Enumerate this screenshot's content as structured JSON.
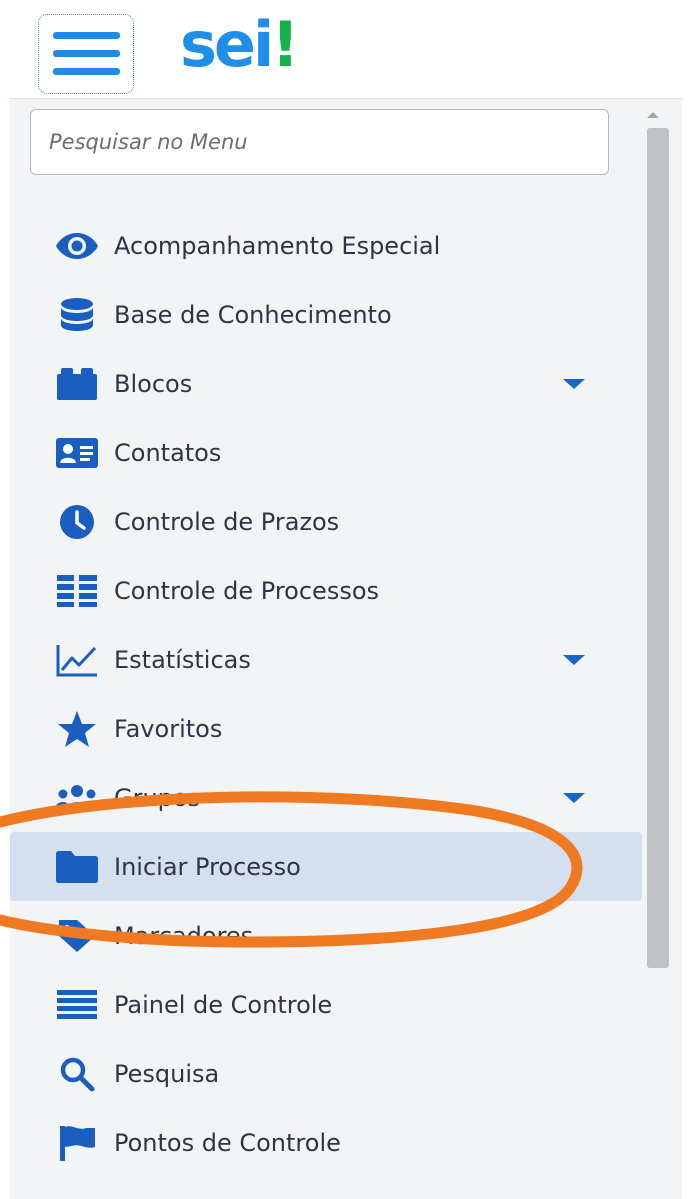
{
  "header": {
    "logo_text": "sei",
    "logo_exclamation": "!",
    "logo_color": "#1f8ee8",
    "logo_accent_color": "#13b24b"
  },
  "search": {
    "placeholder": "Pesquisar no Menu",
    "value": ""
  },
  "menu": {
    "items": [
      {
        "label": "Acompanhamento Especial",
        "icon": "eye-icon",
        "has_submenu": false,
        "active": false
      },
      {
        "label": "Base de Conhecimento",
        "icon": "database-icon",
        "has_submenu": false,
        "active": false
      },
      {
        "label": "Blocos",
        "icon": "cubes-icon",
        "has_submenu": true,
        "active": false
      },
      {
        "label": "Contatos",
        "icon": "address-card-icon",
        "has_submenu": false,
        "active": false
      },
      {
        "label": "Controle de Prazos",
        "icon": "clock-icon",
        "has_submenu": false,
        "active": false
      },
      {
        "label": "Controle de Processos",
        "icon": "list-grid-icon",
        "has_submenu": false,
        "active": false
      },
      {
        "label": "Estatísticas",
        "icon": "line-chart-icon",
        "has_submenu": true,
        "active": false
      },
      {
        "label": "Favoritos",
        "icon": "star-icon",
        "has_submenu": false,
        "active": false
      },
      {
        "label": "Grupos",
        "icon": "users-icon",
        "has_submenu": true,
        "active": false
      },
      {
        "label": "Iniciar Processo",
        "icon": "folder-icon",
        "has_submenu": false,
        "active": true
      },
      {
        "label": "Marcadores",
        "icon": "tag-icon",
        "has_submenu": false,
        "active": false
      },
      {
        "label": "Painel de Controle",
        "icon": "bars-icon",
        "has_submenu": false,
        "active": false
      },
      {
        "label": "Pesquisa",
        "icon": "search-icon",
        "has_submenu": false,
        "active": false
      },
      {
        "label": "Pontos de Controle",
        "icon": "flag-icon",
        "has_submenu": false,
        "active": false
      }
    ]
  },
  "colors": {
    "icon_blue": "#1a5fbf",
    "sidebar_bg": "#f3f4f6",
    "active_bg": "#d5e0ee",
    "annotation_orange": "#f07a22"
  }
}
